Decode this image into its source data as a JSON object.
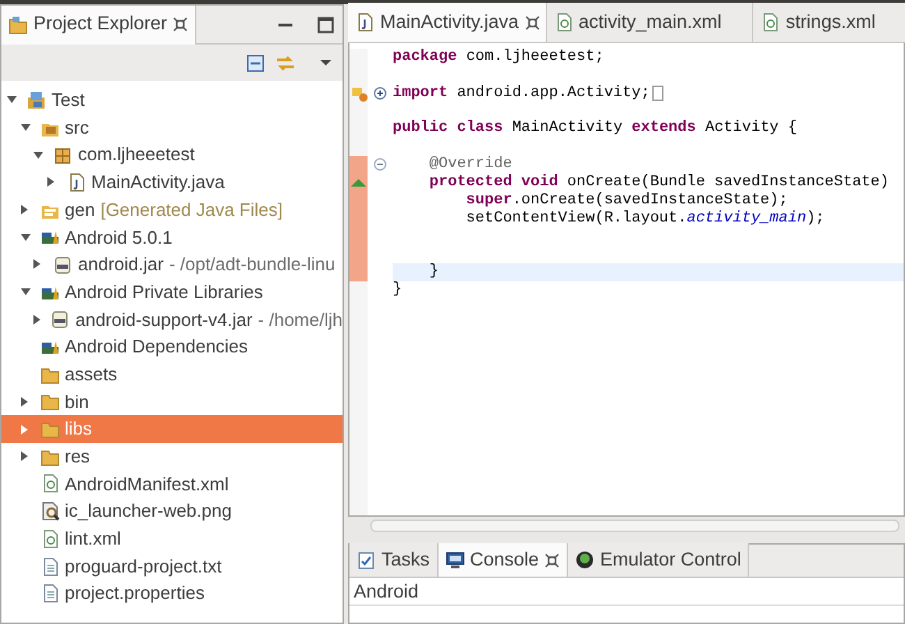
{
  "explorer": {
    "title": "Project Explorer",
    "tree": [
      {
        "label": "Test",
        "kind": "project",
        "expanded": true,
        "selected": false,
        "children": [
          {
            "label": "src",
            "kind": "source-folder",
            "expanded": true,
            "selected": false,
            "children": [
              {
                "label": "com.ljheeetest",
                "kind": "package",
                "expanded": true,
                "selected": false,
                "children": [
                  {
                    "label": "MainActivity.java",
                    "kind": "java-file",
                    "expanded": false,
                    "selected": false
                  }
                ]
              }
            ]
          },
          {
            "label": "gen",
            "decoration": "[Generated Java Files]",
            "kind": "gen-folder",
            "expanded": false,
            "selected": false
          },
          {
            "label": "Android 5.0.1",
            "kind": "library",
            "expanded": true,
            "selected": false,
            "children": [
              {
                "label": "android.jar",
                "decoration": "- /opt/adt-bundle-linu",
                "kind": "jar",
                "expanded": false,
                "selected": false
              }
            ]
          },
          {
            "label": "Android Private Libraries",
            "kind": "library",
            "expanded": true,
            "selected": false,
            "children": [
              {
                "label": "android-support-v4.jar",
                "decoration": "- /home/ljh",
                "kind": "jar",
                "expanded": false,
                "selected": false
              }
            ]
          },
          {
            "label": "Android Dependencies",
            "kind": "library",
            "selected": false
          },
          {
            "label": "assets",
            "kind": "folder",
            "selected": false
          },
          {
            "label": "bin",
            "kind": "folder",
            "expanded": false,
            "selected": false
          },
          {
            "label": "libs",
            "kind": "folder",
            "expanded": false,
            "selected": true
          },
          {
            "label": "res",
            "kind": "folder",
            "expanded": false,
            "selected": false
          },
          {
            "label": "AndroidManifest.xml",
            "kind": "xml-file",
            "selected": false
          },
          {
            "label": "ic_launcher-web.png",
            "kind": "image-file",
            "selected": false
          },
          {
            "label": "lint.xml",
            "kind": "xml-file",
            "selected": false
          },
          {
            "label": "proguard-project.txt",
            "kind": "text-file",
            "selected": false
          },
          {
            "label": "project.properties",
            "kind": "text-file",
            "selected": false
          }
        ]
      }
    ]
  },
  "editor": {
    "tabs": [
      {
        "label": "MainActivity.java",
        "kind": "java-file",
        "selected": true
      },
      {
        "label": "activity_main.xml",
        "kind": "xml-file",
        "selected": false
      },
      {
        "label": "strings.xml",
        "kind": "xml-file",
        "selected": false
      }
    ],
    "lines": [
      {
        "code": "**package** com.ljheeetest;",
        "changed": false,
        "current": false
      },
      {
        "changed": false,
        "current": false
      },
      {
        "code": "**import** android.app.Activity;",
        "collapsed": true,
        "gutter_icon": {
          "kind": "warning"
        },
        "changed": false,
        "current": false
      },
      {
        "changed": false,
        "current": false
      },
      {
        "code": "**public** **class** MainActivity **extends** Activity {",
        "changed": false,
        "current": false,
        "children": [
          {
            "changed": false,
            "current": false
          },
          {
            "code": "@Override",
            "kind": "annotation",
            "collapsed": false,
            "changed": true,
            "current": false
          },
          {
            "code": "**protected** **void** onCreate(Bundle savedInstanceState)",
            "gutter_icon": {
              "kind": "override"
            },
            "changed": true,
            "current": false,
            "children": [
              {
                "code": "**super**.onCreate(savedInstanceState);",
                "changed": true,
                "current": false
              },
              {
                "code": "setContentView(R.layout.*activity_main*);",
                "changed": true,
                "current": false
              },
              {
                "changed": true,
                "current": false
              },
              {
                "changed": true,
                "current": false
              }
            ]
          },
          {
            "code": "}",
            "changed": true,
            "current": true
          }
        ]
      },
      {
        "code": "}",
        "changed": false,
        "current": false
      }
    ]
  },
  "bottom": {
    "tabs": [
      {
        "label": "Tasks",
        "kind": "tasks",
        "selected": false
      },
      {
        "label": "Console",
        "kind": "console",
        "selected": true
      },
      {
        "label": "Emulator Control",
        "kind": "emulator",
        "selected": false
      }
    ],
    "console_title": "Android"
  }
}
